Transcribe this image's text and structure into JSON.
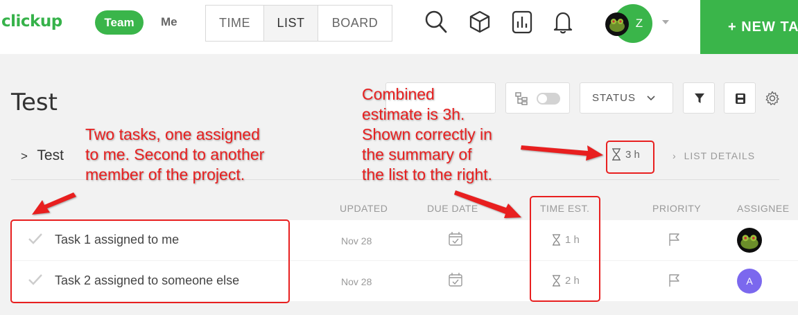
{
  "topbar": {
    "logo": "clickup",
    "team_label": "Team",
    "me_label": "Me",
    "view_tabs": [
      "TIME",
      "LIST",
      "BOARD"
    ],
    "active_view": "LIST",
    "user_initial": "Z",
    "new_task_label": "+ NEW TA"
  },
  "toolbar": {
    "status_label": "STATUS"
  },
  "page": {
    "title": "Test",
    "list_name": "Test",
    "list_chevron": ">",
    "estimate_total": "3 h",
    "list_details_label": "LIST DETAILS"
  },
  "columns": [
    "UPDATED",
    "DUE DATE",
    "TIME EST.",
    "PRIORITY",
    "ASSIGNEE"
  ],
  "tasks": [
    {
      "name": "Task 1 assigned to me",
      "updated": "Nov 28",
      "time_est": "1 h",
      "assignee": "avatar-image"
    },
    {
      "name": "Task 2 assigned to someone else",
      "updated": "Nov 28",
      "time_est": "2 h",
      "assignee": "A"
    }
  ],
  "annotations": {
    "left_note": [
      "Two tasks, one assigned",
      "to me. Second to another",
      "member of the project."
    ],
    "right_note": [
      "Combined",
      "estimate is 3h.",
      "Shown correctly in",
      "the summary of",
      "the list to the right."
    ],
    "color": "#e81f1f"
  },
  "colors": {
    "brand_green": "#3ab54a",
    "assignee_purple": "#7b68ee"
  }
}
